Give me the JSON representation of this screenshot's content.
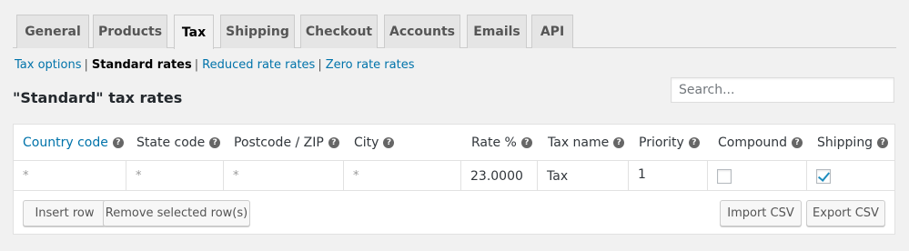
{
  "tabs": [
    {
      "label": "General"
    },
    {
      "label": "Products"
    },
    {
      "label": "Tax"
    },
    {
      "label": "Shipping"
    },
    {
      "label": "Checkout"
    },
    {
      "label": "Accounts"
    },
    {
      "label": "Emails"
    },
    {
      "label": "API"
    }
  ],
  "subnav": {
    "tax_options": "Tax options",
    "separator": "|",
    "standard_rates": "Standard rates",
    "reduced_rates": "Reduced rate rates",
    "zero_rates": "Zero rate rates"
  },
  "heading": "\"Standard\" tax rates",
  "search": {
    "placeholder": "Search..."
  },
  "table": {
    "help_glyph": "?",
    "columns": [
      "Country code",
      "State code",
      "Postcode / ZIP",
      "City",
      "Rate %",
      "Tax name",
      "Priority",
      "Compound",
      "Shipping"
    ],
    "row": {
      "country": "*",
      "state": "*",
      "postcode": "*",
      "city": "*",
      "rate": "23.0000",
      "tax_name": "Tax",
      "priority": "1",
      "compound": false,
      "shipping": true
    }
  },
  "buttons": {
    "insert_row": "Insert row",
    "remove_rows": "Remove selected row(s)",
    "import_csv": "Import CSV",
    "export_csv": "Export CSV"
  },
  "colors": {
    "link": "#0073aa",
    "check": "#1e8cbe",
    "background": "#f1f1f1"
  }
}
